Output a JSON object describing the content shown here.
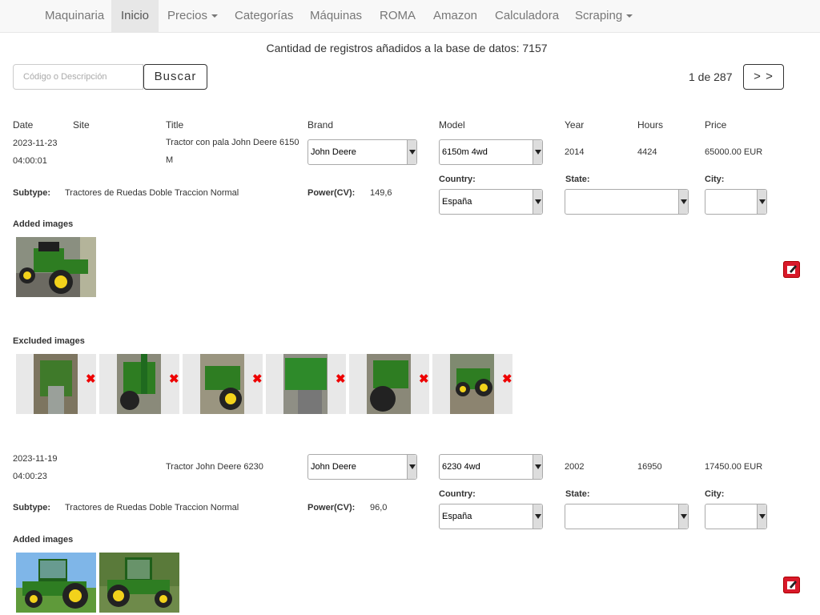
{
  "navbar": {
    "items": [
      {
        "label": "Maquinaria",
        "active": false,
        "dropdown": false
      },
      {
        "label": "Inicio",
        "active": true,
        "dropdown": false
      },
      {
        "label": "Precios",
        "active": false,
        "dropdown": true
      },
      {
        "label": "Categorías",
        "active": false,
        "dropdown": false
      },
      {
        "label": "Máquinas",
        "active": false,
        "dropdown": false
      },
      {
        "label": "ROMA",
        "active": false,
        "dropdown": false
      },
      {
        "label": "Amazon",
        "active": false,
        "dropdown": false
      },
      {
        "label": "Calculadora",
        "active": false,
        "dropdown": false
      },
      {
        "label": "Scraping",
        "active": false,
        "dropdown": true
      }
    ]
  },
  "header": {
    "count_text": "Cantidad de registros añadidos a la base de datos: 7157"
  },
  "search": {
    "placeholder": "Código o Descripción",
    "button_label": "Buscar"
  },
  "pagination": {
    "text": "1 de 287",
    "next_label": "> >"
  },
  "columns": {
    "date": "Date",
    "site": "Site",
    "title": "Title",
    "brand": "Brand",
    "model": "Model",
    "year": "Year",
    "hours": "Hours",
    "price": "Price"
  },
  "labels": {
    "subtype": "Subtype:",
    "power": "Power(CV):",
    "country": "Country:",
    "state": "State:",
    "city": "City:",
    "added_images": "Added images",
    "excluded_images": "Excluded images"
  },
  "records": [
    {
      "date": "2023-11-23",
      "time": "04:00:01",
      "site": "",
      "title": "Tractor con pala John Deere 6150 M",
      "brand": "John Deere",
      "model": "6150m 4wd",
      "year": "2014",
      "hours": "4424",
      "price": "65000.00 EUR",
      "subtype": "Tractores de Ruedas Doble Traccion Normal",
      "power": "149,6",
      "country": "España",
      "state": "",
      "city": "",
      "added_images": [
        "green-tractor-side-photo"
      ],
      "excluded_images": [
        "tractor-rear-photo",
        "tractor-loader-photo",
        "tractor-front-photo",
        "tractor-tank-photo",
        "tractor-wheel-photo",
        "tractor-field-photo"
      ]
    },
    {
      "date": "2023-11-19",
      "time": "04:00:23",
      "site": "",
      "title": "Tractor John Deere 6230",
      "brand": "John Deere",
      "model": "6230 4wd",
      "year": "2002",
      "hours": "16950",
      "price": "17450.00 EUR",
      "subtype": "Tractores de Ruedas Doble Traccion Normal",
      "power": "96,0",
      "country": "España",
      "state": "",
      "city": "",
      "added_images": [
        "tractor-grass-side-photo",
        "tractor-field-front-photo"
      ],
      "excluded_images": []
    }
  ],
  "colors": {
    "tractor_green": "#2e7d22",
    "wheel_yellow": "#f2d21b",
    "delete_red": "#e00000",
    "edit_red": "#d9192a"
  }
}
